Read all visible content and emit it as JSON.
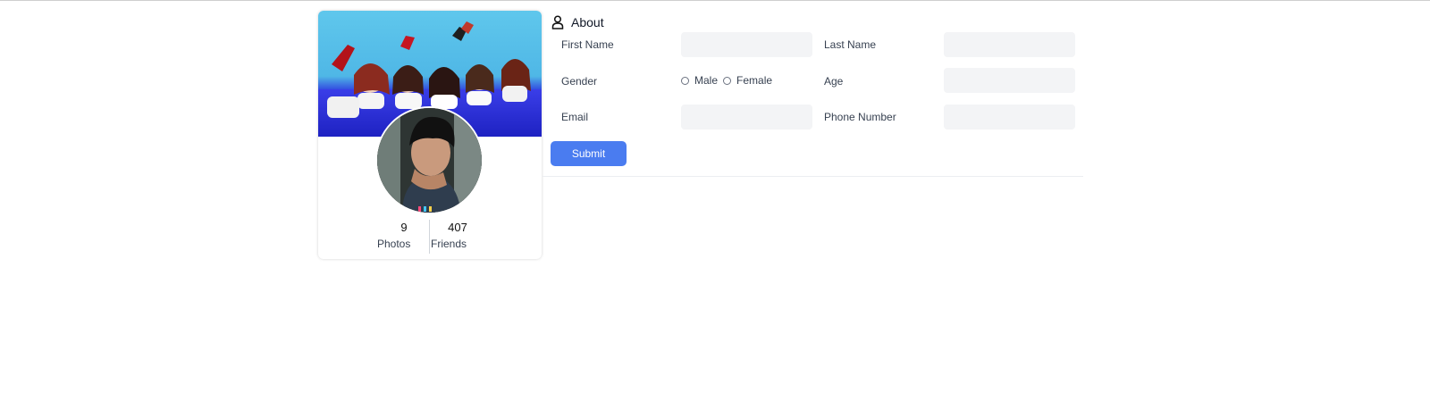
{
  "profile": {
    "photos_count": "9",
    "photos_label": "Photos",
    "friends_count": "407",
    "friends_label": "Friends"
  },
  "about": {
    "title": "About",
    "icon": "user-icon",
    "fields": {
      "first_name_label": "First Name",
      "first_name_value": "",
      "last_name_label": "Last Name",
      "last_name_value": "",
      "gender_label": "Gender",
      "gender_options": [
        "Male",
        "Female"
      ],
      "age_label": "Age",
      "age_value": "",
      "email_label": "Email",
      "email_value": "",
      "phone_label": "Phone Number",
      "phone_value": ""
    },
    "submit_label": "Submit"
  },
  "colors": {
    "accent": "#4a7cf0",
    "input_bg": "#f3f4f6"
  }
}
